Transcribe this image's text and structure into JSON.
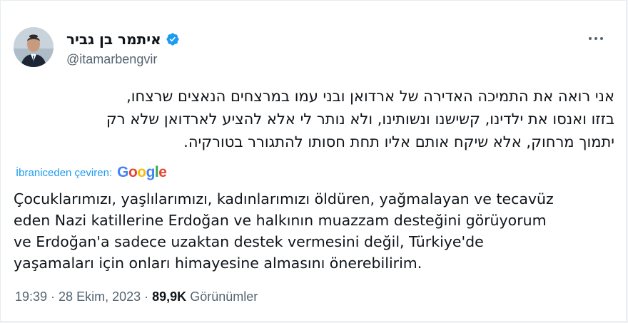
{
  "user": {
    "display_name": "איתמר בן גביר",
    "handle": "@itamarbengvir"
  },
  "tweet": {
    "text_lines": [
      "אני רואה את התמיכה האדירה של ארדואן ובני עמו במרצחים הנאצים שרצחו,",
      "בזזו ואנסו את ילדינו, קשישנו ונשותינו, ולא נותר לי אלא להציע לארדואן שלא רק",
      "יתמוך מרחוק, אלא שיקח אותם אליו תחת חסותו להתגורר בטורקיה."
    ]
  },
  "translation": {
    "label": "İbraniceden çeviren:",
    "provider": "Google",
    "provider_colors": [
      "#4285F4",
      "#EA4335",
      "#FBBC05",
      "#4285F4",
      "#34A853",
      "#EA4335"
    ],
    "lines": [
      "Çocuklarımızı, yaşlılarımızı, kadınlarımızı öldüren, yağmalayan ve tecavüz",
      "eden Nazi katillerine Erdoğan ve halkının muazzam desteğini görüyorum",
      "ve Erdoğan'a sadece uzaktan destek vermesini değil, Türkiye'de",
      "yaşamaları için onları himayesine almasını önerebilirim."
    ]
  },
  "meta": {
    "time": "19:39",
    "separator": " · ",
    "date": "28 Ekim, 2023",
    "views_count": "89,9K",
    "views_label": "Görünümler"
  },
  "colors": {
    "accent": "#1d9bf0",
    "text_primary": "#0f1419",
    "text_secondary": "#536471"
  },
  "icons": {
    "verified": "verified-badge-icon",
    "more": "more-options-icon"
  }
}
